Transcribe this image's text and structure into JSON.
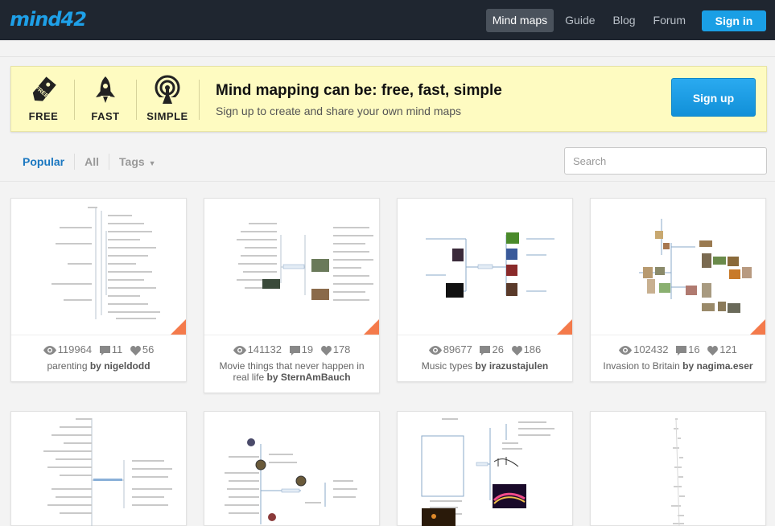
{
  "nav": {
    "logo": "mind42",
    "items": [
      "Mind maps",
      "Guide",
      "Blog",
      "Forum"
    ],
    "signin": "Sign in"
  },
  "banner": {
    "features": [
      "FREE",
      "FAST",
      "SIMPLE"
    ],
    "tag_text": "FREE",
    "title": "Mind mapping can be: free, fast, simple",
    "subtitle": "Sign up to create and share your own mind maps",
    "signup": "Sign up"
  },
  "filters": {
    "popular": "Popular",
    "all": "All",
    "tags": "Tags"
  },
  "search": {
    "placeholder": "Search"
  },
  "by": "by",
  "cards": [
    {
      "views": "119964",
      "comments": "11",
      "likes": "56",
      "title": "parenting",
      "author": "nigeldodd"
    },
    {
      "views": "141132",
      "comments": "19",
      "likes": "178",
      "title": "Movie things that never happen in real life",
      "author": "SternAmBauch"
    },
    {
      "views": "89677",
      "comments": "26",
      "likes": "186",
      "title": "Music types",
      "author": "irazustajulen"
    },
    {
      "views": "102432",
      "comments": "16",
      "likes": "121",
      "title": "Invasion to Britain",
      "author": "nagima.eser"
    }
  ],
  "icons": {
    "views": "eye-icon",
    "comments": "comment-icon",
    "likes": "heart-icon",
    "free": "tag-icon",
    "fast": "rocket-icon",
    "simple": "broadcast-icon"
  },
  "colors": {
    "topbar": "#1f2630",
    "accent": "#1a9fe5",
    "banner": "#fefbc1",
    "corner": "#f47a4b",
    "active_filter": "#1a77c0"
  }
}
